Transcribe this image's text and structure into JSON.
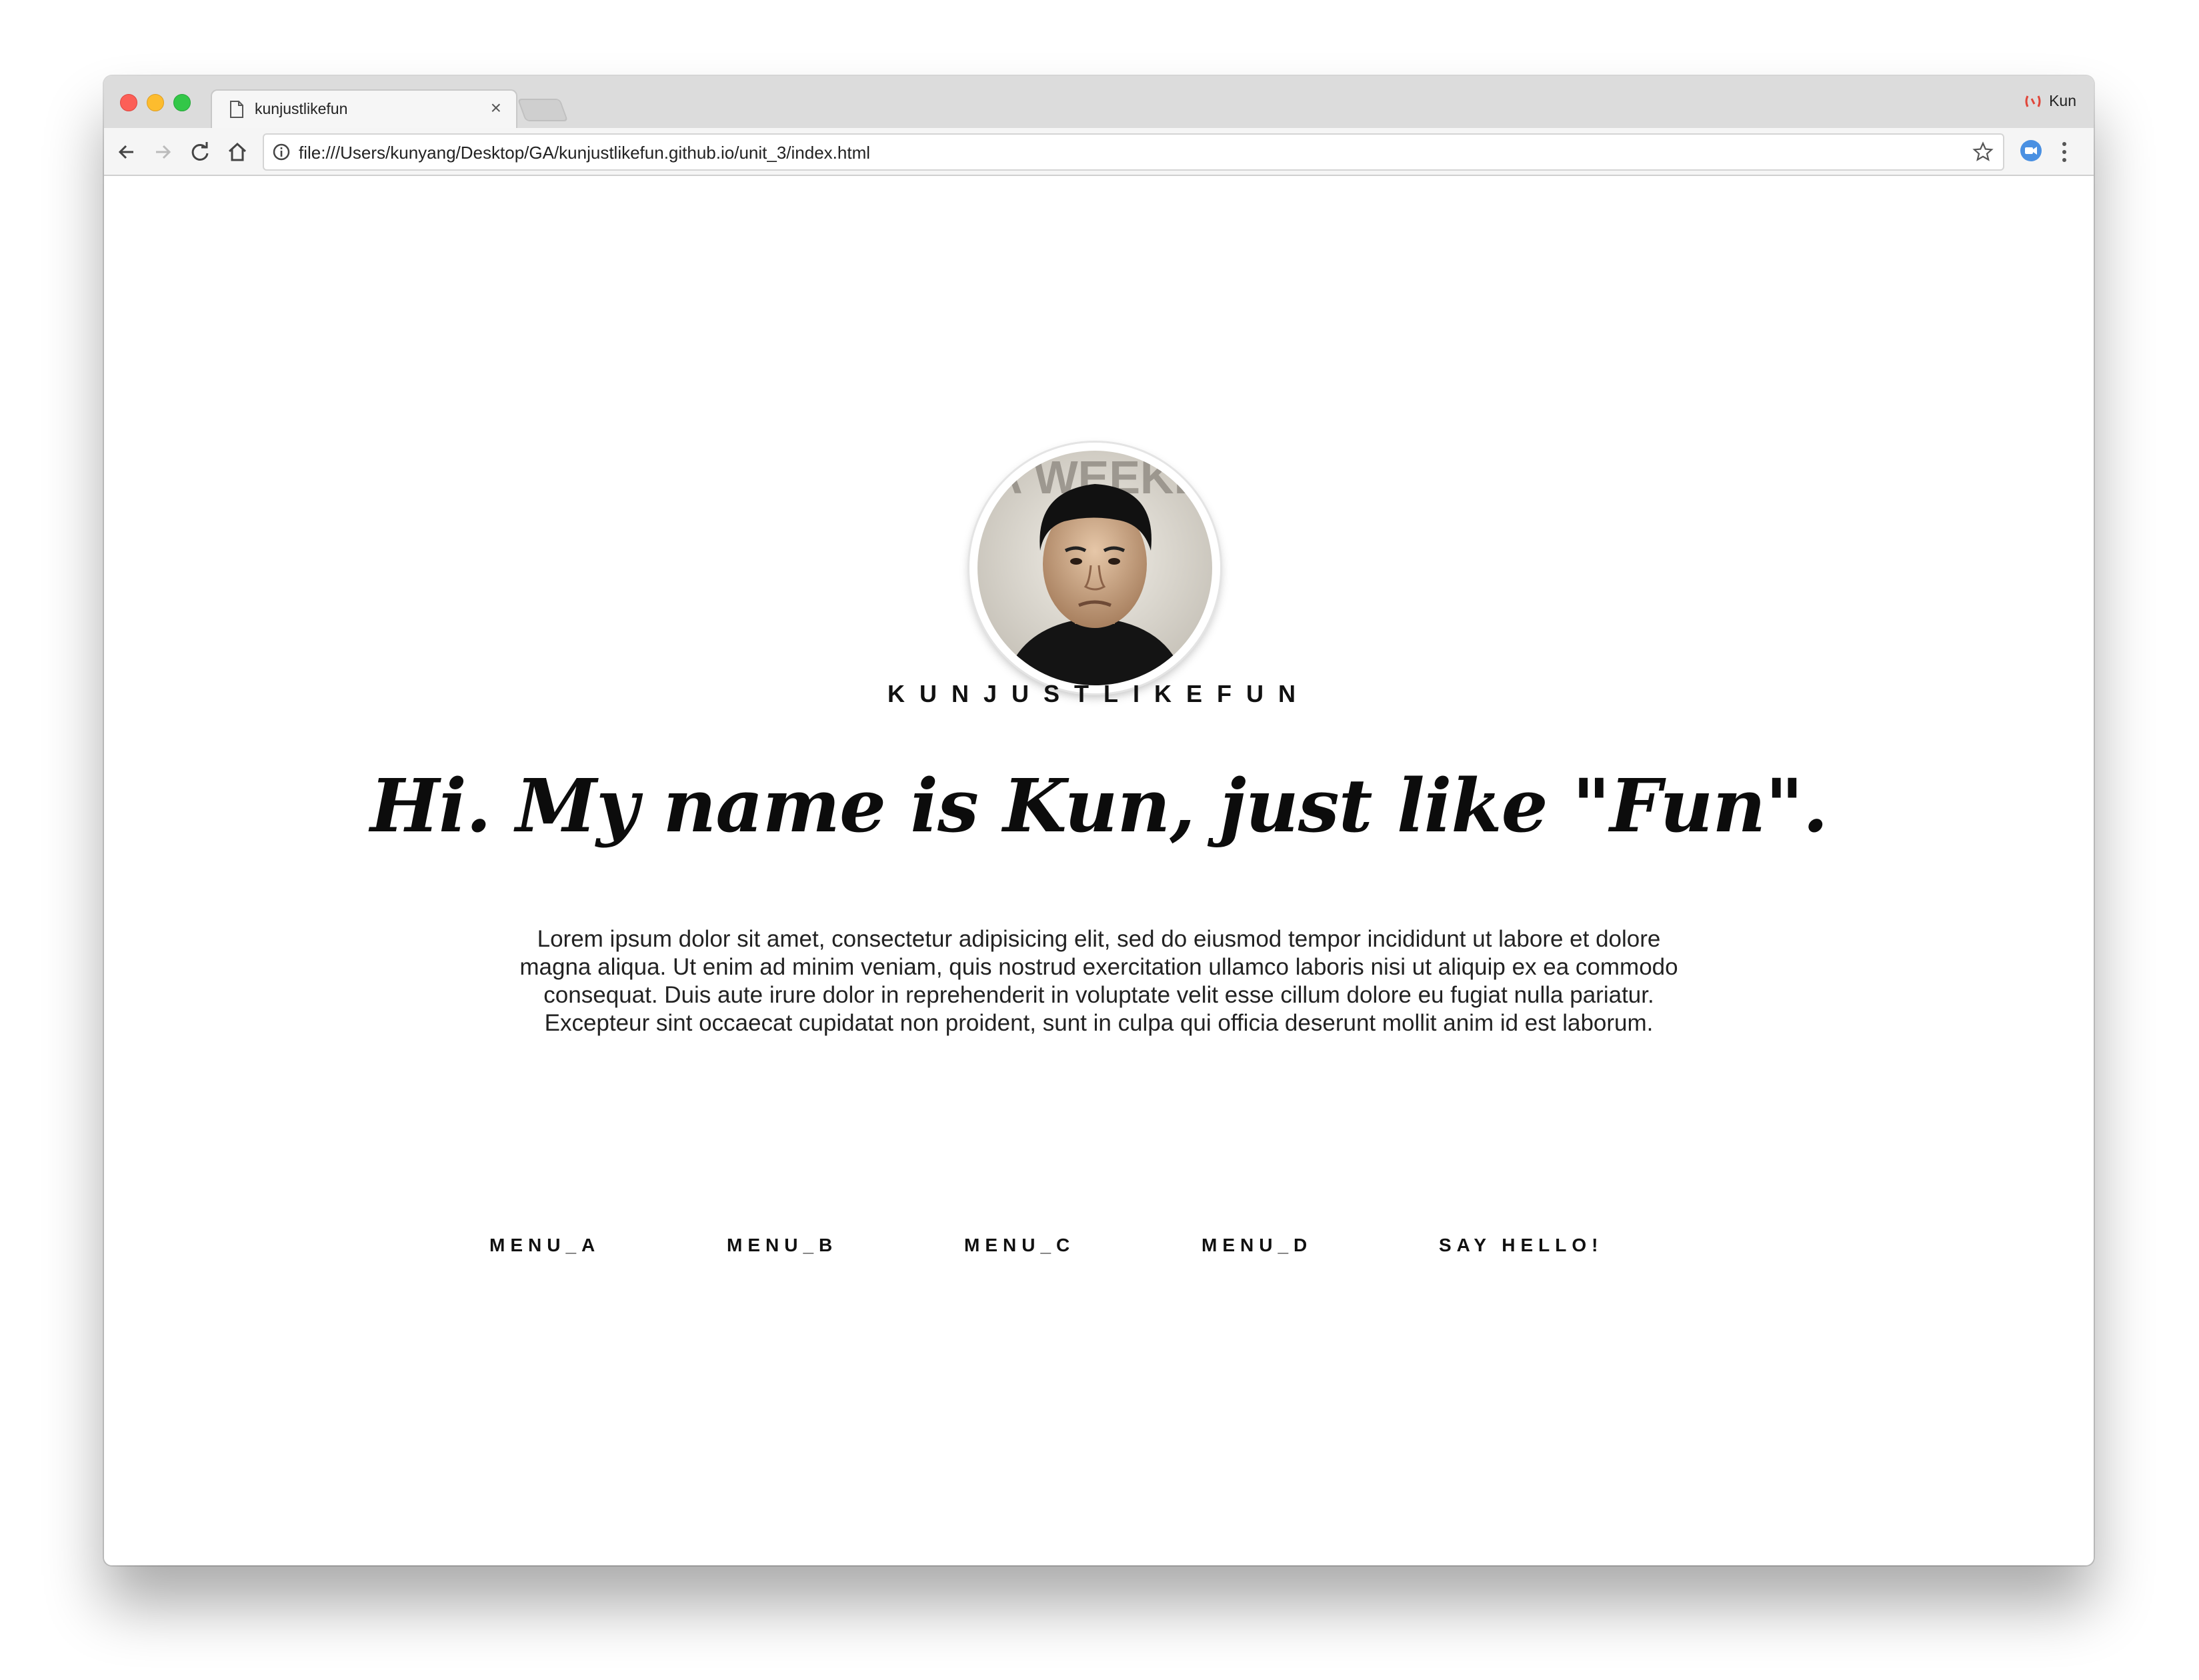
{
  "browser": {
    "tab_title": "kunjustlikefun",
    "tab_close": "×",
    "profile_name": "Kun",
    "url": "file:///Users/kunyang/Desktop/GA/kunjustlikefun.github.io/unit_3/index.html"
  },
  "page": {
    "site_name": "KUNJUSTLIKEFUN",
    "headline": "Hi. My name is Kun, just like \"Fun\".",
    "intro": "Lorem ipsum dolor sit amet, consectetur adipisicing elit, sed do eiusmod tempor incididunt ut labore et dolore magna aliqua. Ut enim ad minim veniam, quis nostrud exercitation ullamco laboris nisi ut aliquip ex ea commodo consequat. Duis aute irure dolor in reprehenderit in voluptate velit esse cillum dolore eu fugiat nulla pariatur. Excepteur sint occaecat cupidatat non proident, sunt in culpa qui officia deserunt mollit anim id est laborum.",
    "nav": {
      "menu_a": "MENU_A",
      "menu_b": "MENU_B",
      "menu_c": "MENU_C",
      "menu_d": "MENU_D",
      "say_hello": "SAY HELLO!"
    },
    "avatar_lettering": "LA WEEKLY"
  }
}
